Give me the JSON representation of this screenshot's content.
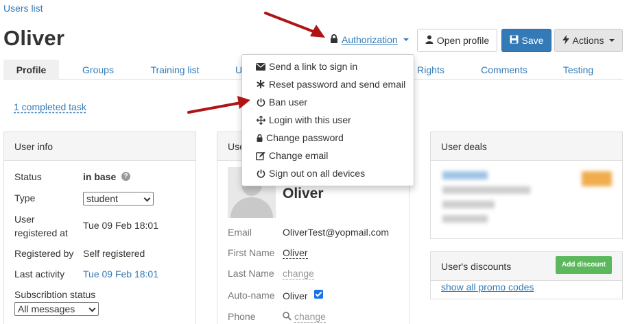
{
  "breadcrumb": "Users list",
  "page_title": "Oliver",
  "header": {
    "authorization_label": "Authorization",
    "open_profile_label": "Open profile",
    "save_label": "Save",
    "actions_label": "Actions"
  },
  "tabs": [
    "Profile",
    "Groups",
    "Training list",
    "U",
    "Rights",
    "Comments",
    "Testing"
  ],
  "completed_task_link": "1 completed task",
  "user_info": {
    "title": "User info",
    "status_label": "Status",
    "status_value": "in base",
    "type_label": "Type",
    "type_value": "student",
    "registered_label_1": "User",
    "registered_label_2": "registered at",
    "registered_value": "Tue 09 Feb 18:01",
    "registered_by_label": "Registered by",
    "registered_by_value": "Self registered",
    "last_activity_label": "Last activity",
    "last_activity_value": "Tue 09 Feb 18:01",
    "subscription_label": "Subscribtion status",
    "subscription_value": "All messages"
  },
  "user_panel": {
    "title": "Use",
    "name": "Oliver",
    "email_label": "Email",
    "email_value": "OliverTest@yopmail.com",
    "first_name_label": "First Name",
    "first_name_value": "Oliver",
    "last_name_label": "Last Name",
    "last_name_value": "change",
    "auto_name_label": "Auto-name",
    "auto_name_value": "Oliver",
    "phone_label": "Phone",
    "phone_value": "change"
  },
  "user_deals": {
    "title": "User deals"
  },
  "discounts": {
    "title": "User's discounts",
    "add_button": "Add discount",
    "show_link": "show all promo codes"
  },
  "dropdown_items": [
    {
      "label": "Send a link to sign in",
      "icon": "envelope-icon"
    },
    {
      "label": "Reset password and send email",
      "icon": "asterisk-icon"
    },
    {
      "label": "Ban user",
      "icon": "power-icon"
    },
    {
      "label": "Login with this user",
      "icon": "move-icon"
    },
    {
      "label": "Change password",
      "icon": "lock-icon"
    },
    {
      "label": "Change email",
      "icon": "edit-icon"
    },
    {
      "label": "Sign out on all devices",
      "icon": "power-icon"
    }
  ],
  "colors": {
    "link": "#337ab7",
    "primary": "#337ab7",
    "success": "#5cb85c",
    "warning": "#f0ad4e",
    "annotation_arrow": "#b01515"
  }
}
